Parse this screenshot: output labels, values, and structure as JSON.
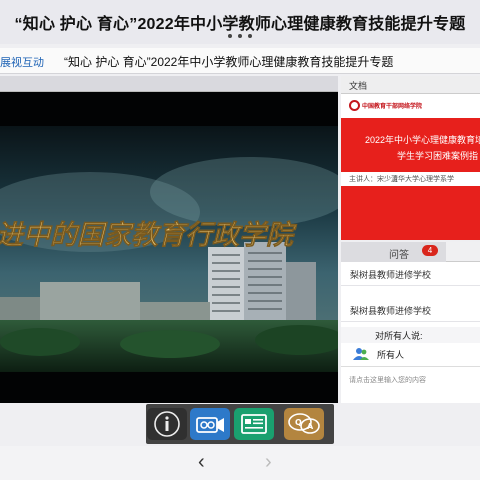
{
  "page": {
    "title": "“知心 护心 育心”2022年中小学教师心理健康教育技能提升专题"
  },
  "app_bar": {
    "brand": "展视互动",
    "title": "“知心 护心 育心”2022年中小学教师心理健康教育技能提升专题"
  },
  "video": {
    "caption": "进中的国家教育行政学院"
  },
  "document": {
    "header": "文档",
    "slide": {
      "logo_text": "中国教育干部网络学院",
      "title_line1": "2022年中小学心理健康教育培",
      "title_line2": "学生学习困难案例指",
      "speaker": "主讲人：宋少卫",
      "affiliation": "清华大学心理学系学"
    }
  },
  "qa": {
    "tab_label": "问答",
    "badge_count": "4",
    "messages": [
      {
        "text": "梨树县教师进修学校"
      },
      {
        "text": "梨树县教师进修学校"
      }
    ],
    "to_label": "对所有人说:",
    "recipient": "所有人",
    "input_placeholder": "请点击这里输入您的内容"
  },
  "toolbar": {
    "buttons": [
      {
        "name": "info",
        "icon": "info-icon"
      },
      {
        "name": "camera",
        "icon": "camera-icon"
      },
      {
        "name": "document",
        "icon": "document-icon"
      },
      {
        "name": "qa",
        "icon": "qa-bubble-icon"
      }
    ]
  },
  "nav": {
    "back": "‹",
    "forward": "›"
  },
  "colors": {
    "slide_red": "#e7201c",
    "badge_red": "#d9261c",
    "camera_blue": "#2d79c9",
    "doc_green": "#1aa06f",
    "qa_gold": "#b3853f"
  }
}
